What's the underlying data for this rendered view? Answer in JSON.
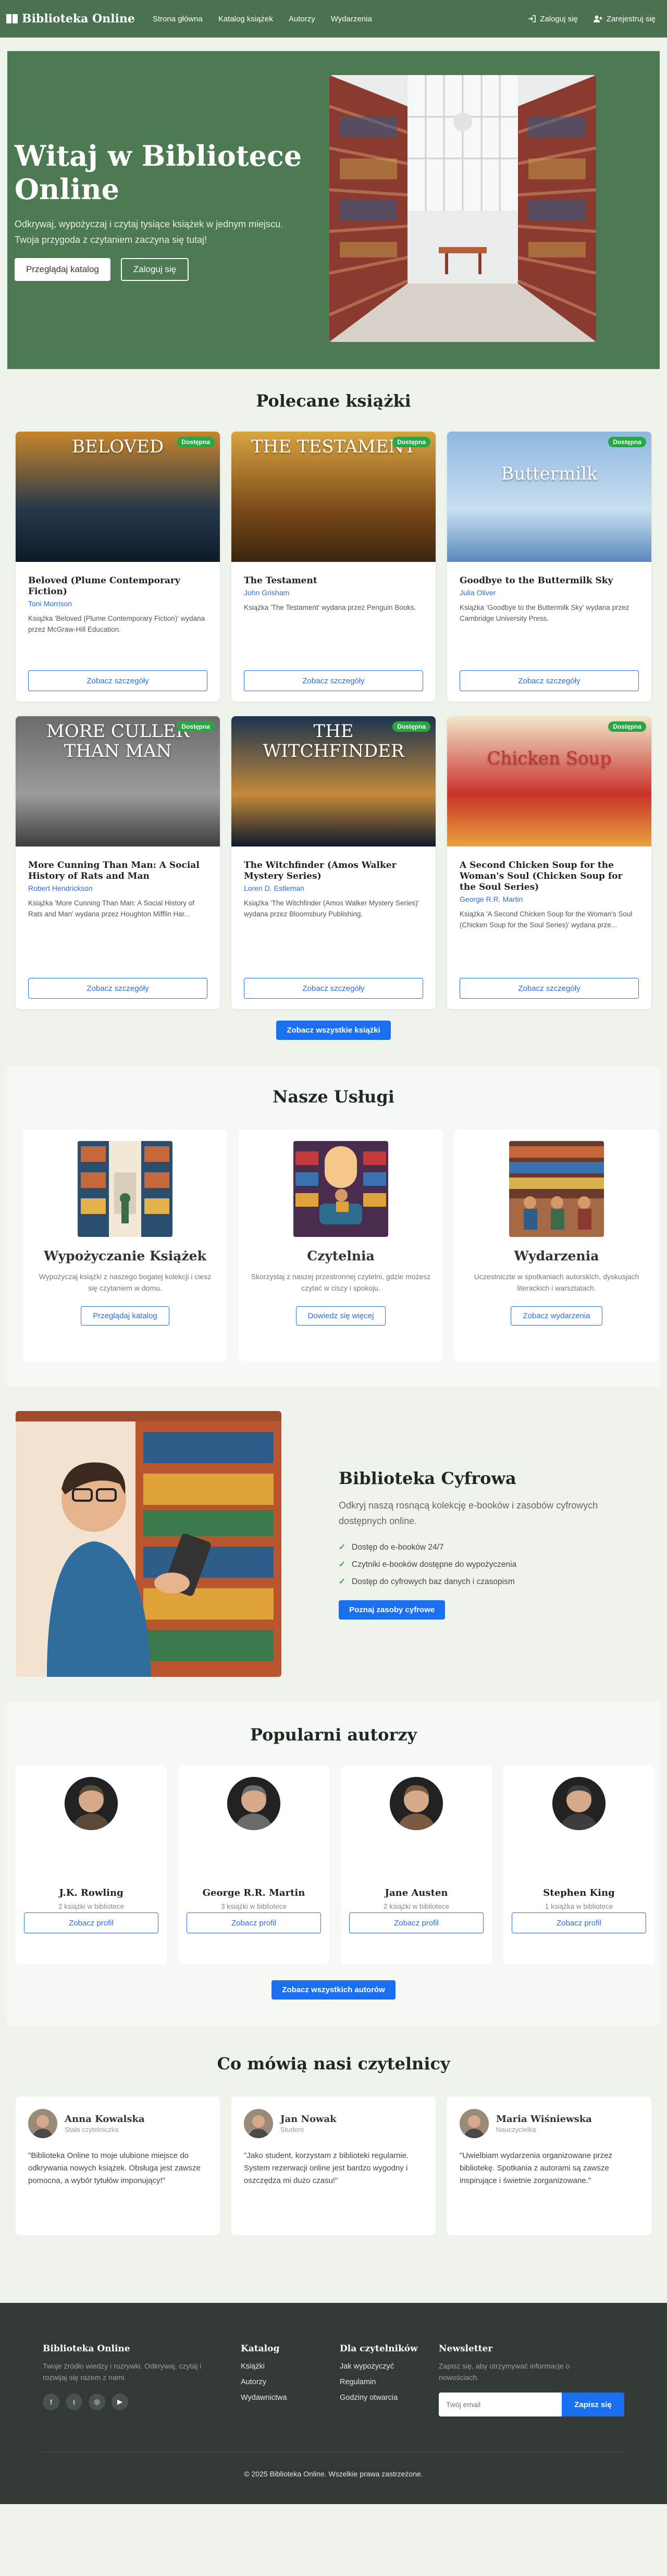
{
  "nav": {
    "brand": "Biblioteka Online",
    "links": [
      "Strona główna",
      "Katalog książek",
      "Autorzy",
      "Wydarzenia"
    ],
    "login": "Zaloguj się",
    "register": "Zarejestruj się"
  },
  "hero": {
    "title": "Witaj w Bibliotece Online",
    "subtitle": "Odkrywaj, wypożyczaj i czytaj tysiące książek w jednym miejscu. Twoja przygoda z czytaniem zaczyna się tutaj!",
    "btn_catalog": "Przeglądaj katalog",
    "btn_login": "Zaloguj się"
  },
  "featured": {
    "title": "Polecane książki",
    "badge": "Dostępna",
    "details_label": "Zobacz szczegóły",
    "all_label": "Zobacz wszystkie książki",
    "books": [
      {
        "title": "Beloved (Plume Contemporary Fiction)",
        "author": "Toni Morrison",
        "desc": "Książka 'Beloved (Plume Contemporary Fiction)' wydana przez McGraw-Hill Education.",
        "cover_text": "BELOVED",
        "colors": [
          "#c9852b",
          "#26384a",
          "#0d1b28"
        ]
      },
      {
        "title": "The Testament",
        "author": "John Grisham",
        "desc": "Książka 'The Testament' wydana przez Penguin Books.",
        "cover_text": "THE TESTAMENT",
        "colors": [
          "#d9a441",
          "#7a4a18",
          "#3b2410"
        ]
      },
      {
        "title": "Goodbye to the Buttermilk Sky",
        "author": "Julia Oliver",
        "desc": "Książka 'Goodbye to the Buttermilk Sky' wydana przez Cambridge University Press.",
        "cover_text": "Buttermilk",
        "colors": [
          "#8fb8e0",
          "#c9dff1",
          "#5a88bd"
        ]
      },
      {
        "title": "More Cunning Than Man: A Social History of Rats and Man",
        "author": "Robert Hendrickson",
        "desc": "Książka 'More Cunning Than Man: A Social History of Rats and Man' wydana przez Houghton Mifflin Har...",
        "cover_text": "MORE CULLER THAN MAN",
        "colors": [
          "#6b6b6b",
          "#9c9c9c",
          "#3d3d3d"
        ]
      },
      {
        "title": "The Witchfinder (Amos Walker Mystery Series)",
        "author": "Loren D. Estleman",
        "desc": "Książka 'The Witchfinder (Amos Walker Mystery Series)' wydana przez Bloomsbury Publishing.",
        "cover_text": "THE WITCHFINDER",
        "colors": [
          "#1c3450",
          "#c4893a",
          "#0e1b2a"
        ]
      },
      {
        "title": "A Second Chicken Soup for the Woman's Soul (Chicken Soup for the Soul Series)",
        "author": "George R.R. Martin",
        "desc": "Książka 'A Second Chicken Soup for the Woman's Soul (Chicken Soup for the Soul Series)' wydana prze...",
        "cover_text": "Chicken Soup",
        "colors": [
          "#f2e6c9",
          "#c9312b",
          "#e8a33a"
        ]
      }
    ]
  },
  "services": {
    "title": "Nasze Usługi",
    "items": [
      {
        "title": "Wypożyczanie Książek",
        "desc": "Wypożyczaj książki z naszego bogatej kolekcji i ciesz się czytaniem w domu.",
        "btn": "Przeglądaj katalog"
      },
      {
        "title": "Czytelnia",
        "desc": "Skorzystaj z naszej przestronnej czytelni, gdzie możesz czytać w ciszy i spokoju.",
        "btn": "Dowiedz się więcej"
      },
      {
        "title": "Wydarzenia",
        "desc": "Uczestniczte w spotkaniach autorskich, dyskusjach literackich i warsztatach.",
        "btn": "Zobacz wydarzenia"
      }
    ]
  },
  "digital": {
    "title": "Biblioteka Cyfrowa",
    "subtitle": "Odkryj naszą rosnącą kolekcję e-booków i zasobów cyfrowych dostępnych online.",
    "features": [
      "Dostęp do e-booków 24/7",
      "Czytniki e-booków dostępne do wypożyczenia",
      "Dostęp do cyfrowych baz danych i czasopism"
    ],
    "btn": "Poznaj zasoby cyfrowe"
  },
  "authors": {
    "title": "Popularni autorzy",
    "profile_label": "Zobacz profil",
    "all_label": "Zobacz wszystkich autorów",
    "items": [
      {
        "name": "J.K. Rowling",
        "count": "2 książki w bibliotece"
      },
      {
        "name": "George R.R. Martin",
        "count": "3 książki w bibliotece"
      },
      {
        "name": "Jane Austen",
        "count": "2 książki w bibliotece"
      },
      {
        "name": "Stephen King",
        "count": "1 książka w bibliotece"
      }
    ]
  },
  "reviews": {
    "title": "Co mówią nasi czytelnicy",
    "items": [
      {
        "name": "Anna Kowalska",
        "role": "Stała czytelniczka",
        "text": "\"Biblioteka Online to moje ulubione miejsce do odkrywania nowych książek. Obsługa jest zawsze pomocna, a wybór tytułów imponujący!\""
      },
      {
        "name": "Jan Nowak",
        "role": "Student",
        "text": "\"Jako student, korzystam z biblioteki regularnie. System rezerwacji online jest bardzo wygodny i oszczędza mi dużo czasu!\""
      },
      {
        "name": "Maria Wiśniewska",
        "role": "Nauczycielka",
        "text": "\"Uwielbiam wydarzenia organizowane przez bibliotekę. Spotkania z autorami są zawsze inspirujące i świetnie zorganizowane.\""
      }
    ]
  },
  "footer": {
    "brand": "Biblioteka Online",
    "brand_desc": "Twoje źródło wiedzy i rozrywki. Odkrywaj, czytaj i rozwijaj się razem z nami.",
    "col1_title": "Katalog",
    "col1": [
      "Książki",
      "Autorzy",
      "Wydawnictwa"
    ],
    "col2_title": "Dla czytelników",
    "col2": [
      "Jak wypożyczyć",
      "Regulamin",
      "Godziny otwarcia"
    ],
    "news_title": "Newsletter",
    "news_desc": "Zapisz się, aby otrzymywać informacje o nowościach.",
    "email_placeholder": "Twój email",
    "subscribe": "Zapisz się",
    "copyright": "© 2025 Biblioteka Online. Wszelkie prawa zastrzeżone."
  }
}
